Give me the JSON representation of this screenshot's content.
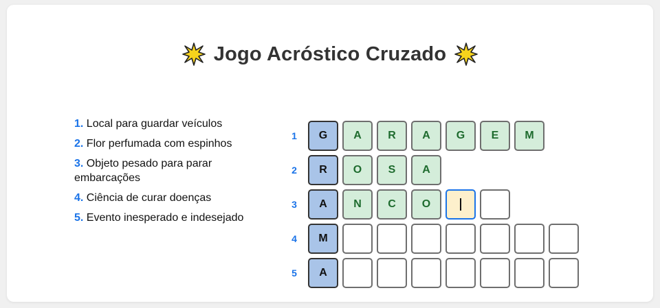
{
  "title": "Jogo Acróstico Cruzado",
  "icons": {
    "left": "star-icon",
    "right": "star-icon"
  },
  "colors": {
    "key_cell": "#a9c4e8",
    "filled_cell": "#d4edda",
    "filled_text": "#1e6b2e",
    "active_cell": "#fdf0cc",
    "accent": "#1a73e8"
  },
  "clues": [
    {
      "num": "1.",
      "text": "Local para guardar veículos"
    },
    {
      "num": "2.",
      "text": "Flor perfumada com espinhos"
    },
    {
      "num": "3.",
      "text": "Objeto pesado para parar embarcações"
    },
    {
      "num": "4.",
      "text": "Ciência de curar doenças"
    },
    {
      "num": "5.",
      "text": "Evento inesperado e indesejado"
    }
  ],
  "grid": [
    {
      "num": "1",
      "key": "G",
      "cells": [
        "A",
        "R",
        "A",
        "G",
        "E",
        "M"
      ]
    },
    {
      "num": "2",
      "key": "R",
      "cells": [
        "O",
        "S",
        "A"
      ]
    },
    {
      "num": "3",
      "key": "A",
      "cells": [
        "N",
        "C",
        "O",
        "",
        ""
      ]
    },
    {
      "num": "4",
      "key": "M",
      "cells": [
        "",
        "",
        "",
        "",
        "",
        "",
        ""
      ]
    },
    {
      "num": "5",
      "key": "A",
      "cells": [
        "",
        "",
        "",
        "",
        "",
        "",
        ""
      ]
    }
  ]
}
